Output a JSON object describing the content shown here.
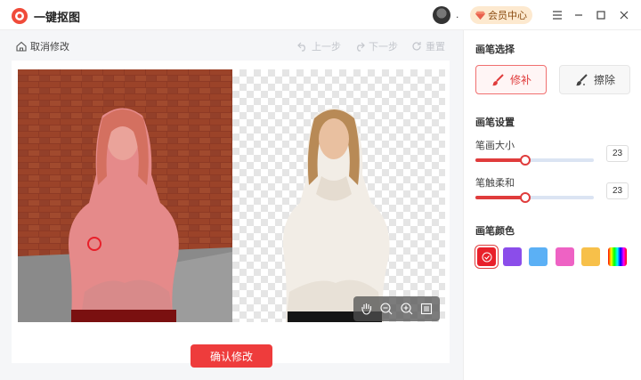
{
  "app": {
    "title": "一键抠图",
    "avatar_dot": "."
  },
  "header": {
    "member_label": "会员中心"
  },
  "toolbar": {
    "cancel_label": "取消修改",
    "undo_label": "上一步",
    "redo_label": "下一步",
    "reset_label": "重置"
  },
  "editor": {
    "confirm_label": "确认修改"
  },
  "panel": {
    "brush_select_title": "画笔选择",
    "repair_label": "修补",
    "erase_label": "擦除",
    "brush_settings_title": "画笔设置",
    "size_label": "笔画大小",
    "size_value": "23",
    "size_fraction": 0.42,
    "softness_label": "笔触柔和",
    "softness_value": "23",
    "softness_fraction": 0.42,
    "brush_color_title": "画笔颜色",
    "colors": [
      "#e8202a",
      "#8b4dea",
      "#5bb0f5",
      "#ee62c4",
      "#f7c04a"
    ]
  }
}
